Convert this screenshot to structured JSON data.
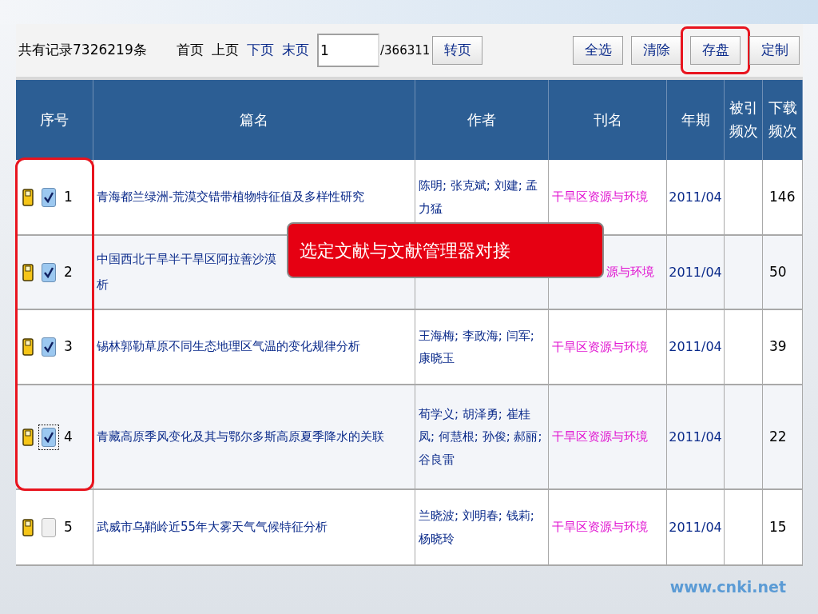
{
  "toolbar": {
    "total": "共有记录7326219条",
    "pager": [
      {
        "label": "首页",
        "enabled": false
      },
      {
        "label": "上页",
        "enabled": false
      },
      {
        "label": "下页",
        "enabled": true
      },
      {
        "label": "末页",
        "enabled": true
      }
    ],
    "page_input": "1",
    "page_total": "/366311",
    "goto_button": "转页",
    "actions": [
      {
        "label": "全选",
        "highlighted": false
      },
      {
        "label": "清除",
        "highlighted": false
      },
      {
        "label": "存盘",
        "highlighted": true
      },
      {
        "label": "定制",
        "highlighted": false
      }
    ]
  },
  "table": {
    "columns": [
      "序号",
      "篇名",
      "作者",
      "刊名",
      "年期",
      "被引频次",
      "下载频次"
    ],
    "rows": [
      {
        "number": "1",
        "checked": true,
        "focused": false,
        "highlighted": true,
        "covered": false,
        "title": "青海都兰绿洲-荒漠交错带植物特征值及多样性研究",
        "authors": "陈明; 张克斌; 刘建; 孟力猛",
        "journal": "干旱区资源与环境",
        "issue": "2011/04",
        "downloads": "146"
      },
      {
        "number": "2",
        "checked": true,
        "focused": false,
        "highlighted": true,
        "covered": true,
        "title": "中国西北干旱半干旱区阿拉善沙漠",
        "title_end": "析",
        "journal": "源与环境",
        "issue": "2011/04",
        "downloads": "50"
      },
      {
        "number": "3",
        "checked": true,
        "focused": false,
        "highlighted": true,
        "covered": false,
        "title": "锡林郭勒草原不同生态地理区气温的变化规律分析",
        "authors": "王海梅; 李政海; 闫军; 康晓玉",
        "journal": "干旱区资源与环境",
        "issue": "2011/04",
        "downloads": "39"
      },
      {
        "number": "4",
        "checked": true,
        "focused": true,
        "highlighted": true,
        "covered": false,
        "title": "青藏高原季风变化及其与鄂尔多斯高原夏季降水的关联",
        "authors": "荀学义; 胡泽勇; 崔桂凤; 何慧根; 孙俊; 郝丽; 谷良雷",
        "journal": "干旱区资源与环境",
        "issue": "2011/04",
        "downloads": "22"
      },
      {
        "number": "5",
        "checked": false,
        "focused": false,
        "highlighted": false,
        "covered": false,
        "title": "武威市乌鞘岭近55年大雾天气气候特征分析",
        "authors": "兰晓波; 刘明春; 钱莉; 杨晓玲",
        "journal": "干旱区资源与环境",
        "issue": "2011/04",
        "downloads": "15"
      }
    ]
  },
  "callout": "选定文献与文献管理器对接",
  "footer_url": "www.cnki.net"
}
